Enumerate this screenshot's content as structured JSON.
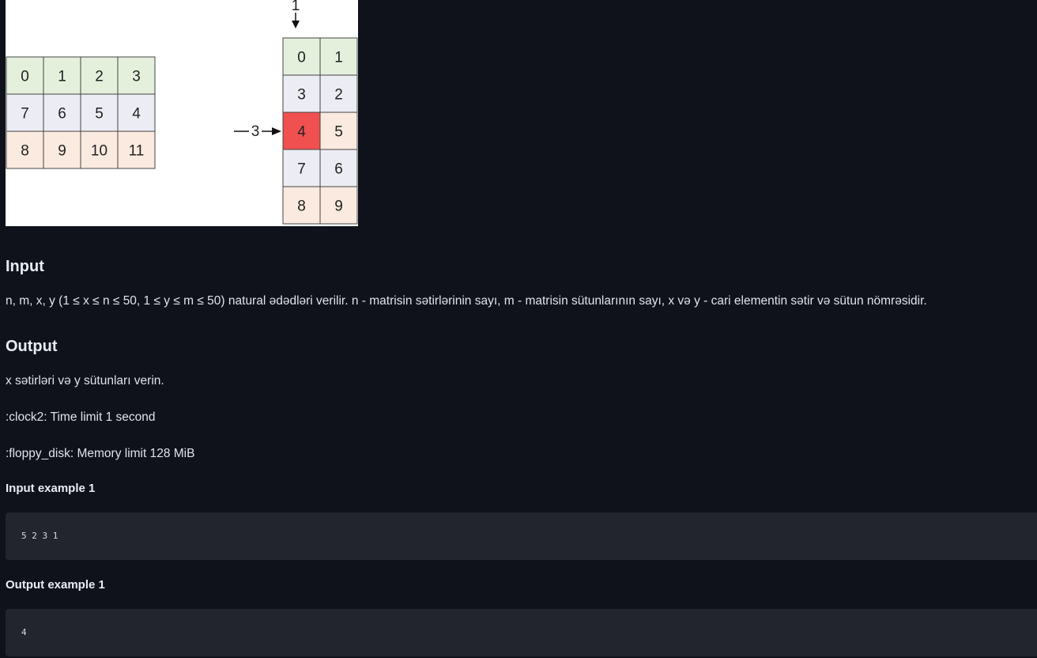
{
  "figure": {
    "left_matrix": [
      [
        "0",
        "1",
        "2",
        "3"
      ],
      [
        "7",
        "6",
        "5",
        "4"
      ],
      [
        "8",
        "9",
        "10",
        "11"
      ]
    ],
    "right_matrix": [
      [
        "0",
        "1"
      ],
      [
        "3",
        "2"
      ],
      [
        "4",
        "5"
      ],
      [
        "7",
        "6"
      ],
      [
        "8",
        "9"
      ]
    ],
    "column_arrow_label": "1",
    "row_arrow_label": "3",
    "highlight_value": "4",
    "colors": {
      "row_green": "#e4f0dc",
      "row_gray": "#ececf4",
      "row_peach": "#fbeadf",
      "highlight": "#f05050"
    }
  },
  "input": {
    "heading": "Input",
    "text": "n, m, x, y (1 ≤ x ≤ n ≤ 50, 1 ≤ y ≤ m ≤ 50) natural ədədləri verilir. n - matrisin sətirlərinin sayı, m - matrisin sütunlarının sayı, x və y - cari elementin sətir və sütun nömrəsidir."
  },
  "output": {
    "heading": "Output",
    "text": "x sətirləri və y sütunları verin."
  },
  "limits": {
    "time": ":clock2: Time limit 1 second",
    "memory": ":floppy_disk: Memory limit 128 MiB"
  },
  "examples": {
    "input_label": "Input example 1",
    "input_value": "5 2 3 1",
    "output_label": "Output example 1",
    "output_value": "4"
  }
}
